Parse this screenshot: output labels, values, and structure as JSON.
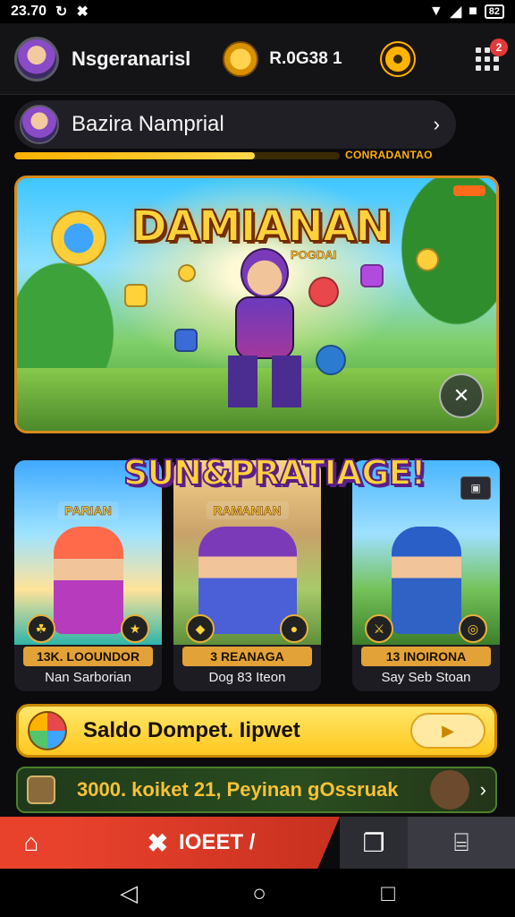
{
  "status_bar": {
    "time": "23.70",
    "battery": "82"
  },
  "header": {
    "username": "Nsgeranarisl",
    "coin_amount": "R.0G38 1",
    "notification_count": "2"
  },
  "profile": {
    "name": "Bazira Namprial",
    "progress_label": "CONRADANTAO",
    "progress_fraction": 0.74
  },
  "hero": {
    "title": "DAMIANAN",
    "subtitle": "POGDAI"
  },
  "section": {
    "title": "SUN&PRATIAGE!"
  },
  "cards": [
    {
      "badge": "PARIAN",
      "label": "13K. LOOUNDOR",
      "name": "Nan Sarborian",
      "icon_left": "leaf-icon",
      "icon_right": "star-icon"
    },
    {
      "badge": "RAMANIAN",
      "label": "3 REANAGA",
      "name": "Dog 83 Iteon",
      "icon_left": "shield-icon",
      "icon_right": "gem-icon"
    },
    {
      "badge": "",
      "label": "13 INOIRONA",
      "name": "Say Seb Stoan",
      "icon_left": "sword-icon",
      "icon_right": "target-icon"
    }
  ],
  "wallet": {
    "label": "Saldo Dompet. Iipwet"
  },
  "promo": {
    "text": "3000. koiket 21, Peyinan gOssruak"
  },
  "bottom_nav": {
    "active_label": "IOEET /"
  },
  "colors": {
    "accent": "#FFB400",
    "nav_active": "#E8422D",
    "background": "#0B0B0D"
  }
}
